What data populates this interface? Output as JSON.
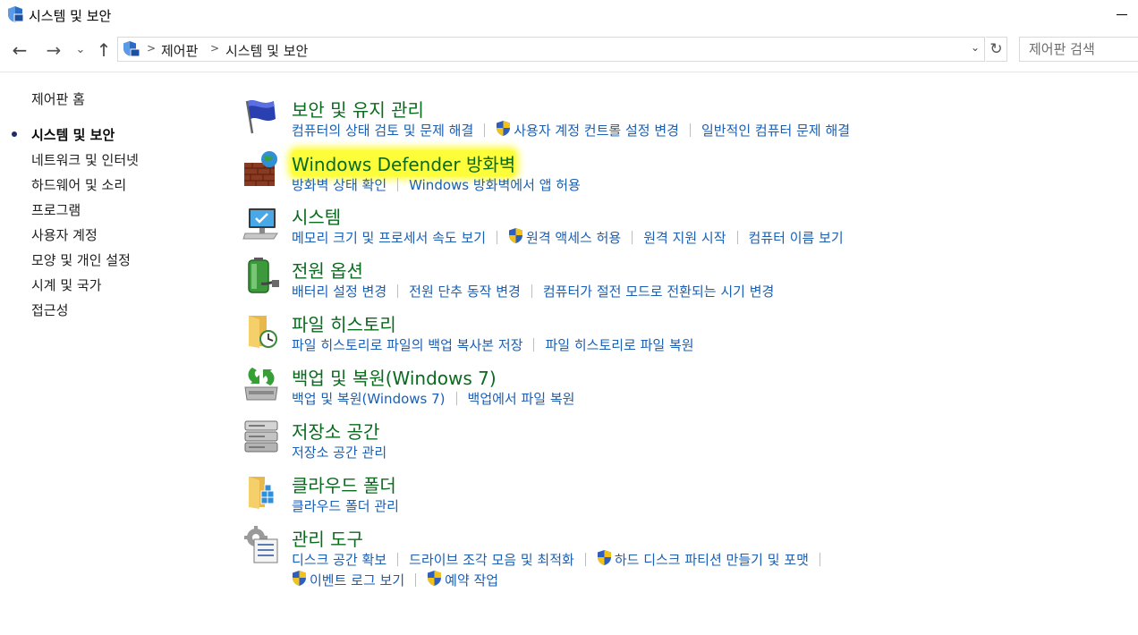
{
  "window": {
    "title": "시스템 및 보안"
  },
  "address_bar": {
    "breadcrumbs": [
      "제어판",
      "시스템 및 보안"
    ],
    "search_placeholder": "제어판 검색"
  },
  "sidebar": {
    "items": [
      {
        "label": "제어판 홈",
        "current": false
      },
      {
        "label": "시스템 및 보안",
        "current": true
      },
      {
        "label": "네트워크 및 인터넷",
        "current": false
      },
      {
        "label": "하드웨어 및 소리",
        "current": false
      },
      {
        "label": "프로그램",
        "current": false
      },
      {
        "label": "사용자 계정",
        "current": false
      },
      {
        "label": "모양 및 개인 설정",
        "current": false
      },
      {
        "label": "시계 및 국가",
        "current": false
      },
      {
        "label": "접근성",
        "current": false
      }
    ]
  },
  "categories": [
    {
      "title": "보안 및 유지 관리",
      "icon": "flag-icon",
      "links": [
        {
          "label": "컴퓨터의 상태 검토 및 문제 해결",
          "shield": false
        },
        {
          "label": "사용자 계정 컨트롤 설정 변경",
          "shield": true
        },
        {
          "label": "일반적인 컴퓨터 문제 해결",
          "shield": false
        }
      ]
    },
    {
      "title": "Windows Defender 방화벽",
      "icon": "firewall-icon",
      "highlighted": true,
      "links": [
        {
          "label": "방화벽 상태 확인",
          "shield": false
        },
        {
          "label": "Windows 방화벽에서 앱 허용",
          "shield": false
        }
      ]
    },
    {
      "title": "시스템",
      "icon": "computer-icon",
      "links": [
        {
          "label": "메모리 크기 및 프로세서 속도 보기",
          "shield": false
        },
        {
          "label": "원격 액세스 허용",
          "shield": true
        },
        {
          "label": "원격 지원 시작",
          "shield": false
        },
        {
          "label": "컴퓨터 이름 보기",
          "shield": false
        }
      ]
    },
    {
      "title": "전원 옵션",
      "icon": "battery-icon",
      "links": [
        {
          "label": "배터리 설정 변경",
          "shield": false
        },
        {
          "label": "전원 단추 동작 변경",
          "shield": false
        },
        {
          "label": "컴퓨터가 절전 모드로 전환되는 시기 변경",
          "shield": false
        }
      ]
    },
    {
      "title": "파일 히스토리",
      "icon": "file-history-icon",
      "links": [
        {
          "label": "파일 히스토리로 파일의 백업 복사본 저장",
          "shield": false
        },
        {
          "label": "파일 히스토리로 파일 복원",
          "shield": false
        }
      ]
    },
    {
      "title": "백업 및 복원(Windows 7)",
      "icon": "backup-icon",
      "links": [
        {
          "label": "백업 및 복원(Windows 7)",
          "shield": false
        },
        {
          "label": "백업에서 파일 복원",
          "shield": false
        }
      ]
    },
    {
      "title": "저장소 공간",
      "icon": "storage-icon",
      "links": [
        {
          "label": "저장소 공간 관리",
          "shield": false
        }
      ]
    },
    {
      "title": "클라우드 폴더",
      "icon": "cloud-folder-icon",
      "links": [
        {
          "label": "클라우드 폴더 관리",
          "shield": false
        }
      ]
    },
    {
      "title": "관리 도구",
      "icon": "admin-tools-icon",
      "links": [
        {
          "label": "디스크 공간 확보",
          "shield": false
        },
        {
          "label": "드라이브 조각 모음 및 최적화",
          "shield": false
        },
        {
          "label": "하드 디스크 파티션 만들기 및 포맷",
          "shield": true
        }
      ],
      "links2": [
        {
          "label": "이벤트 로그 보기",
          "shield": true
        },
        {
          "label": "예약 작업",
          "shield": true
        }
      ]
    }
  ]
}
